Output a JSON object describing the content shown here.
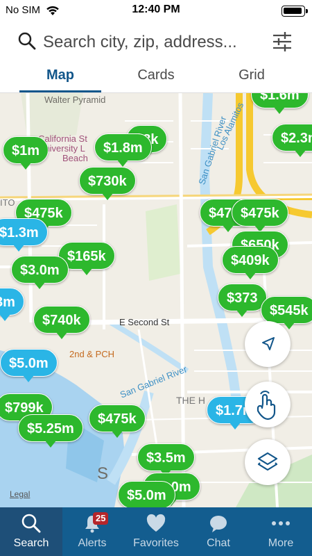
{
  "status": {
    "carrier": "No SIM",
    "time": "12:40 PM"
  },
  "search": {
    "placeholder": "Search city, zip, address..."
  },
  "tabs": [
    {
      "label": "Map",
      "active": true
    },
    {
      "label": "Cards",
      "active": false
    },
    {
      "label": "Grid",
      "active": false
    }
  ],
  "map": {
    "labels": {
      "walter_pyramid": "Walter Pyramid",
      "csu_line1": "California St",
      "csu_line2": "University L",
      "csu_line3": "Beach",
      "san_gabriel_upper": "San Gabriel River",
      "los_alamitos": "Los Alamitos",
      "e_second_st": "E Second St",
      "second_pch": "2nd & PCH",
      "san_gabriel_lower": "San Gabriel River",
      "the_h": "THE H",
      "ito": "ITO",
      "s_partial": "S",
      "legal": "Legal"
    },
    "pins": [
      {
        "price": "$1.6m",
        "color": "green"
      },
      {
        "price": "$2.3m",
        "color": "green"
      },
      {
        "price": "$1m",
        "color": "green"
      },
      {
        "price": "$1.8m",
        "color": "green"
      },
      {
        "price": "$730k",
        "color": "green"
      },
      {
        "price": "$475k",
        "color": "green"
      },
      {
        "price": "$1.3m",
        "color": "blue"
      },
      {
        "price": "$475k",
        "color": "green"
      },
      {
        "price": "$165k",
        "color": "green"
      },
      {
        "price": "$3.0m",
        "color": "green"
      },
      {
        "price": "$409k",
        "color": "green"
      },
      {
        "price": "$373",
        "color": "green"
      },
      {
        "price": "$545k",
        "color": "green"
      },
      {
        "price": "$740k",
        "color": "green"
      },
      {
        "price": "$5.0m",
        "color": "blue"
      },
      {
        "price": "$799k",
        "color": "green"
      },
      {
        "price": "$5.25m",
        "color": "green"
      },
      {
        "price": "$475k",
        "color": "green"
      },
      {
        "price": "$1.7m",
        "color": "blue"
      },
      {
        "price": "$3.5m",
        "color": "green"
      },
      {
        "price": "$5.0m",
        "color": "green"
      },
      {
        "price": "$5.0m",
        "color": "green"
      },
      {
        "price": "$650k",
        "color": "green"
      },
      {
        "price": "3m",
        "color": "blue"
      },
      {
        "price": "$8k",
        "color": "green"
      }
    ]
  },
  "nav": [
    {
      "label": "Search",
      "icon": "search-icon",
      "active": true
    },
    {
      "label": "Alerts",
      "icon": "bell-icon",
      "badge": "25"
    },
    {
      "label": "Favorites",
      "icon": "heart-icon"
    },
    {
      "label": "Chat",
      "icon": "chat-bubble-icon"
    },
    {
      "label": "More",
      "icon": "more-dots-icon"
    }
  ],
  "colors": {
    "brand": "#135d8f",
    "pin_green": "#2db82d",
    "pin_blue": "#2ab5e6",
    "badge": "#b5262b"
  }
}
